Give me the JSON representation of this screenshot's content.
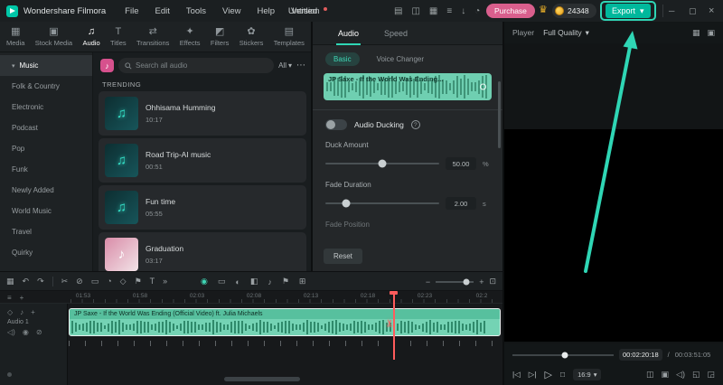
{
  "topbar": {
    "app_title": "Wondershare Filmora",
    "menus": [
      "File",
      "Edit",
      "Tools",
      "View",
      "Help",
      "Version"
    ],
    "project_title": "Untitled",
    "purchase_label": "Purchase",
    "coin_count": "24348",
    "export_label": "Export"
  },
  "media_tabs": [
    "Media",
    "Stock Media",
    "Audio",
    "Titles",
    "Transitions",
    "Effects",
    "Filters",
    "Stickers",
    "Templates"
  ],
  "sidebar": [
    "Music",
    "Folk & Country",
    "Electronic",
    "Podcast",
    "Pop",
    "Funk",
    "Newly Added",
    "World Music",
    "Travel",
    "Quirky"
  ],
  "audio_browser": {
    "search_placeholder": "Search all audio",
    "filter_all": "All",
    "section_title": "TRENDING",
    "tracks": [
      {
        "title": "Ohhisama Humming",
        "duration": "10:17"
      },
      {
        "title": "Road Trip-AI music",
        "duration": "00:51"
      },
      {
        "title": "Fun time",
        "duration": "05:55"
      },
      {
        "title": "Graduation",
        "duration": "03:17"
      }
    ]
  },
  "properties": {
    "tab_audio": "Audio",
    "tab_speed": "Speed",
    "subtab_basic": "Basic",
    "subtab_voice": "Voice Changer",
    "clip_title": "JP Saxe - If the World Was Ending...",
    "ducking_label": "Audio Ducking",
    "duck_amount_label": "Duck Amount",
    "duck_amount_value": "50.00",
    "duck_amount_unit": "%",
    "fade_duration_label": "Fade Duration",
    "fade_duration_value": "2.00",
    "fade_duration_unit": "s",
    "fade_position_label": "Fade Position",
    "reset_label": "Reset"
  },
  "player": {
    "label": "Player",
    "quality": "Full Quality",
    "current_time": "00:02:20:18",
    "time_sep": "/",
    "total_time": "00:03:51:05",
    "aspect_ratio": "16:9"
  },
  "timeline": {
    "ruler_times": [
      "01:53",
      "01:58",
      "02:03",
      "02:08",
      "02:13",
      "02:18",
      "02:23",
      "02:2"
    ],
    "track_label": "Audio 1",
    "clip_title": "JP Saxe - If the World Was Ending (Official Video) ft. Julia Michaels"
  },
  "colors": {
    "accent": "#2fd6b5",
    "purchase_pink": "#d95f8d",
    "coin_gold": "#f0b429",
    "clip_teal": "#74d3b4",
    "playhead_red": "#ff5c5c"
  },
  "icons": {
    "caret_down": "▾",
    "more": "⋯",
    "ai_note": "♪",
    "music_note": "♫",
    "tab_media": "▦",
    "tab_stock": "▣",
    "tab_audio": "♫",
    "tab_titles": "T",
    "tab_transitions": "⇄",
    "tab_effects": "✦",
    "tab_filters": "◩",
    "tab_stickers": "✿",
    "tab_templates": "▤",
    "top_device": "▤",
    "top_layout": "◫",
    "top_panels": "▦",
    "top_list": "≡",
    "top_import": "↓",
    "top_clock": "◔",
    "crown": "♛",
    "win_min": "─",
    "win_max": "▢",
    "win_close": "×",
    "grid_view": "▦",
    "single_view": "▣",
    "prev_frame": "|◁",
    "next_frame": "▷|",
    "play": "▷",
    "stop": "□",
    "snapshot": "◫",
    "monitor": "▣",
    "volume": "◁)",
    "fullscreen": "◱",
    "detach": "◲",
    "workspace": "▦",
    "undo": "↶",
    "redo": "↷",
    "split": "✂",
    "delete": "⊘",
    "crop": "▭",
    "speed": "◔",
    "keyframe": "◇",
    "marker": "⚑",
    "text_tool": "T",
    "chevrons": "»",
    "record": "◉",
    "mask": "◐",
    "chroma": "◧",
    "mic": "♪",
    "render": "⊞",
    "zoom_out": "−",
    "zoom_in": "+",
    "fit": "⊡",
    "track_menu": "≡",
    "add_track": "+",
    "lock": "⊘",
    "mute": "◁)",
    "help": "?",
    "scissors_cursor": "✂"
  }
}
